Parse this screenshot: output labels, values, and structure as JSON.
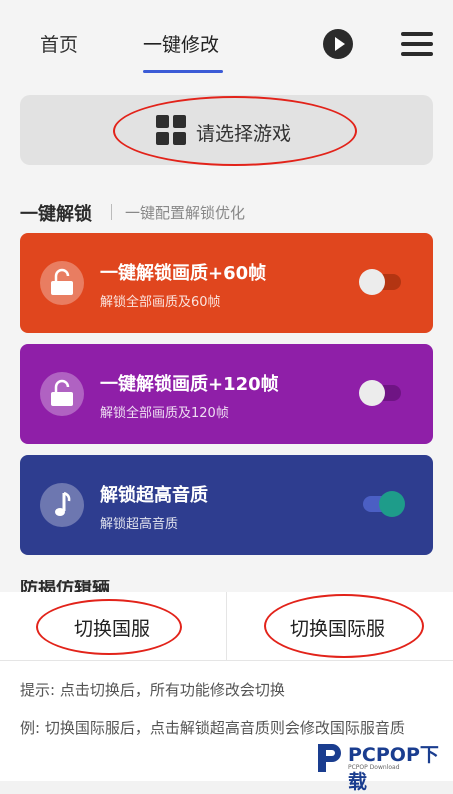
{
  "nav": {
    "tab_home": "首页",
    "tab_modify": "一键修改"
  },
  "game_select": {
    "label": "请选择游戏"
  },
  "section": {
    "title": "一键解锁",
    "subtitle": "一键配置解锁优化"
  },
  "cards": [
    {
      "title": "一键解锁画质+60帧",
      "subtitle": "解锁全部画质及60帧",
      "icon": "unlock-icon",
      "color": "#e0461e",
      "toggle_on": false
    },
    {
      "title": "一键解锁画质+120帧",
      "subtitle": "解锁全部画质及120帧",
      "icon": "unlock-icon",
      "color": "#8f1fa8",
      "toggle_on": false
    },
    {
      "title": "解锁超高音质",
      "subtitle": "解锁超高音质",
      "icon": "music-note-icon",
      "color": "#2e3d8f",
      "toggle_on": true
    }
  ],
  "partial_heading": "防揭仿辑辆",
  "sheet": {
    "switch_cn": "切换国服",
    "switch_intl": "切换国际服",
    "tip1": "提示: 点击切换后，所有功能修改会切换",
    "tip2": "例: 切换国际服后，点击解锁超高音质则会修改国际服音质"
  },
  "watermark": {
    "brand": "PCPOP下载",
    "sub": "PCPOP Download"
  },
  "colors": {
    "accent": "#3b5bd6",
    "annotation_circle": "#e2231a",
    "toggle_on_knob": "#1e9c8a"
  }
}
